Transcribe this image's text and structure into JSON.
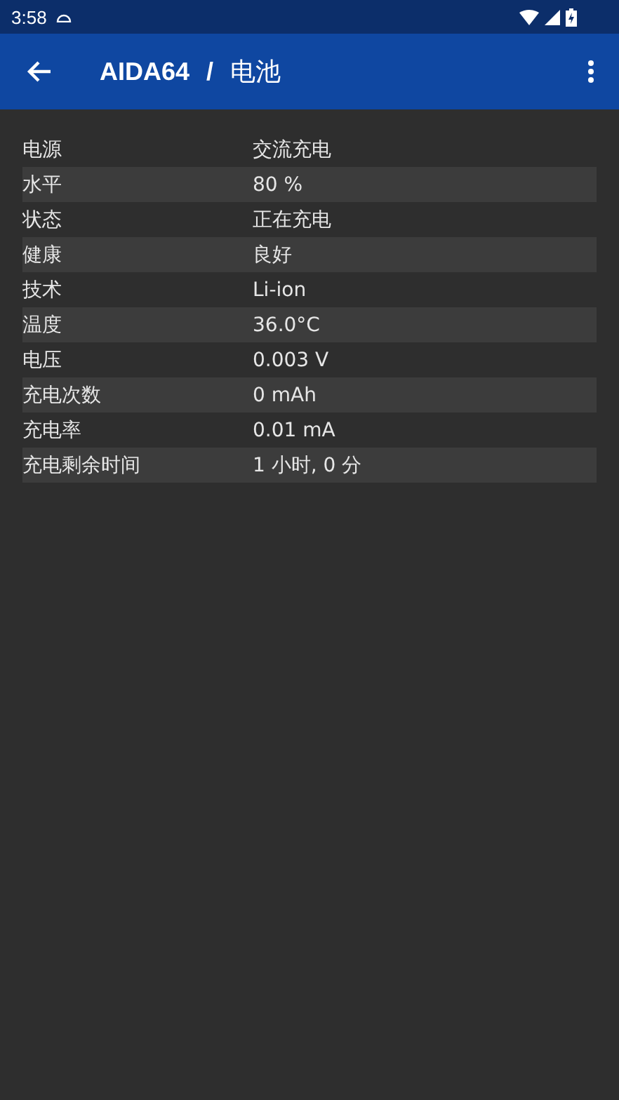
{
  "status_bar": {
    "time": "3:58"
  },
  "app_bar": {
    "title": "AIDA64",
    "separator": "/",
    "subtitle": "电池"
  },
  "rows": [
    {
      "label": "电源",
      "value": "交流充电"
    },
    {
      "label": "水平",
      "value": "80 %"
    },
    {
      "label": "状态",
      "value": "正在充电"
    },
    {
      "label": "健康",
      "value": "良好"
    },
    {
      "label": "技术",
      "value": "Li-ion"
    },
    {
      "label": "温度",
      "value": "36.0°C"
    },
    {
      "label": "电压",
      "value": "0.003 V"
    },
    {
      "label": "充电次数",
      "value": "0 mAh"
    },
    {
      "label": "充电率",
      "value": "0.01 mA"
    },
    {
      "label": "充电剩余时间",
      "value": "1 小时, 0 分"
    }
  ]
}
